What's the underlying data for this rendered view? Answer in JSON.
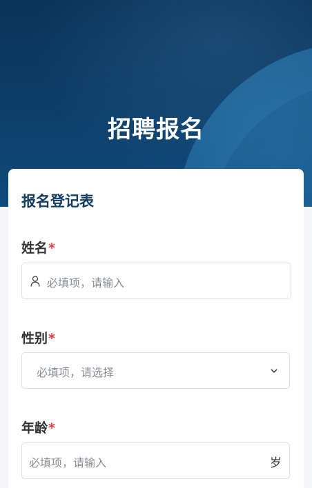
{
  "header": {
    "title": "招聘报名"
  },
  "form": {
    "title": "报名登记表",
    "fields": [
      {
        "label": "姓名",
        "required_mark": "*",
        "placeholder": "必填项，请输入",
        "icon": "user-icon"
      },
      {
        "label": "性别",
        "required_mark": "*",
        "placeholder": "必填项，请选择",
        "icon": "chevron-down-icon"
      },
      {
        "label": "年龄",
        "required_mark": "*",
        "placeholder": "必填项，请输入",
        "suffix": "岁"
      }
    ]
  },
  "colors": {
    "banner": "#0d3c66",
    "accent": "#143c63",
    "required": "#e23b3b"
  }
}
